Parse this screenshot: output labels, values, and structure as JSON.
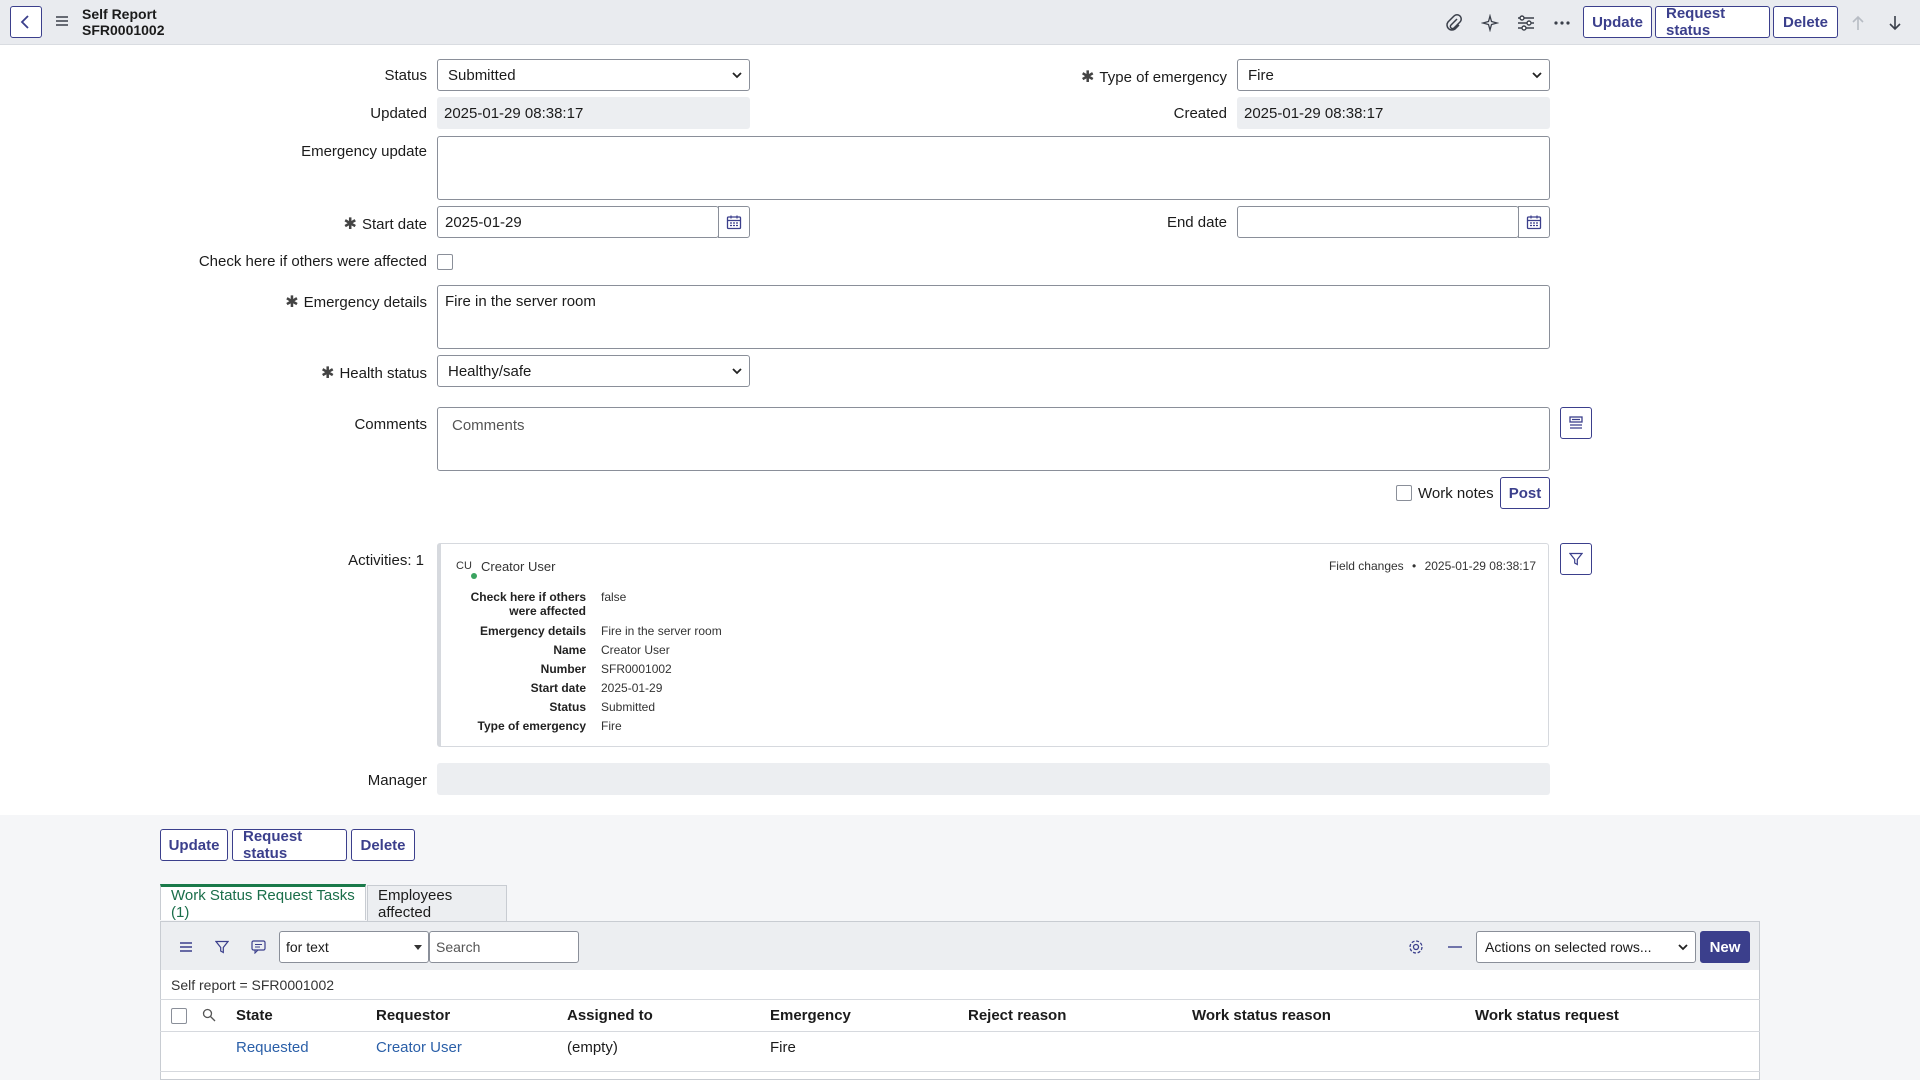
{
  "header": {
    "title": "Self Report",
    "record_number": "SFR0001002",
    "buttons": {
      "update": "Update",
      "request_status": "Request status",
      "delete": "Delete"
    }
  },
  "form": {
    "status": {
      "label": "Status",
      "value": "Submitted"
    },
    "type_of_emergency": {
      "label": "Type of emergency",
      "value": "Fire"
    },
    "updated": {
      "label": "Updated",
      "value": "2025-01-29 08:38:17"
    },
    "created": {
      "label": "Created",
      "value": "2025-01-29 08:38:17"
    },
    "emergency_update": {
      "label": "Emergency update",
      "value": ""
    },
    "start_date": {
      "label": "Start date",
      "value": "2025-01-29"
    },
    "end_date": {
      "label": "End date",
      "value": ""
    },
    "others_affected": {
      "label": "Check here if others were affected",
      "checked": false
    },
    "emergency_details": {
      "label": "Emergency details",
      "value": "Fire in the server room"
    },
    "health_status": {
      "label": "Health status",
      "value": "Healthy/safe"
    },
    "comments": {
      "label": "Comments",
      "placeholder": "Comments"
    },
    "work_notes": {
      "label": "Work notes",
      "checked": false
    },
    "post_button": "Post",
    "manager": {
      "label": "Manager",
      "value": ""
    }
  },
  "activities": {
    "label": "Activities: 1",
    "entry": {
      "avatar_initials": "CU",
      "user": "Creator User",
      "type": "Field changes",
      "bullet": "•",
      "timestamp": "2025-01-29 08:38:17",
      "fields": [
        {
          "key": "Check here if others were affected",
          "value": "false"
        },
        {
          "key": "Emergency details",
          "value": "Fire in the server room"
        },
        {
          "key": "Name",
          "value": "Creator User"
        },
        {
          "key": "Number",
          "value": "SFR0001002"
        },
        {
          "key": "Start date",
          "value": "2025-01-29"
        },
        {
          "key": "Status",
          "value": "Submitted"
        },
        {
          "key": "Type of emergency",
          "value": "Fire"
        }
      ]
    }
  },
  "bottom_buttons": {
    "update": "Update",
    "request_status": "Request status",
    "delete": "Delete"
  },
  "related_lists": {
    "tabs": [
      {
        "label": "Work Status Request Tasks (1)",
        "active": true
      },
      {
        "label": "Employees affected",
        "active": false
      }
    ],
    "search_field": "for text",
    "search_placeholder": "Search",
    "actions_select": "Actions on selected rows...",
    "new_button": "New",
    "filter_text": "Self report = SFR0001002",
    "columns": [
      "State",
      "Requestor",
      "Assigned to",
      "Emergency",
      "Reject reason",
      "Work status reason",
      "Work status request"
    ],
    "rows": [
      {
        "state": "Requested",
        "requestor": "Creator User",
        "assigned_to": "(empty)",
        "emergency": "Fire",
        "reject_reason": "",
        "work_status_reason": "",
        "work_status_request": ""
      }
    ]
  },
  "colors": {
    "accent": "#3b3f8c",
    "active_tab": "#1a7a4a",
    "link": "#2a5fa8",
    "header_bg": "#e9ebef"
  },
  "icons": [
    "back-arrow-icon",
    "hamburger-icon",
    "paperclip-icon",
    "sparkle-icon",
    "settings-sliders-icon",
    "more-icon",
    "arrow-up-icon",
    "arrow-down-icon",
    "calendar-icon",
    "stream-icon",
    "filter-icon",
    "search-icon",
    "gear-icon",
    "minus-icon"
  ]
}
